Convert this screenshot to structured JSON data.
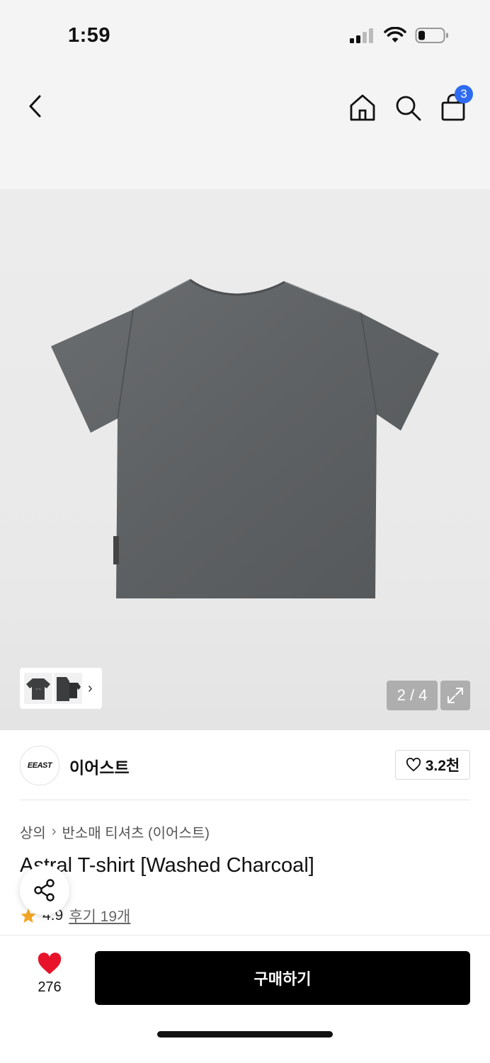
{
  "status_bar": {
    "time": "1:59"
  },
  "nav": {
    "cart_count": "3"
  },
  "gallery": {
    "page_indicator": "2 / 4"
  },
  "brand": {
    "logo_text": "EEAST",
    "name": "이어스트",
    "likes": "3.2천"
  },
  "breadcrumb": {
    "category": "상의",
    "subcategory": "반소매 티셔츠 (이어스트)"
  },
  "product": {
    "title": "Astral T-shirt [Washed Charcoal]",
    "rating": "4.9",
    "reviews": "후기 19개"
  },
  "bottom": {
    "wish_count": "276",
    "buy_label": "구매하기"
  },
  "colors": {
    "accent_badge": "#2f6bf2",
    "heart": "#e8132a",
    "star": "#f5a623",
    "buy": "#000000"
  }
}
